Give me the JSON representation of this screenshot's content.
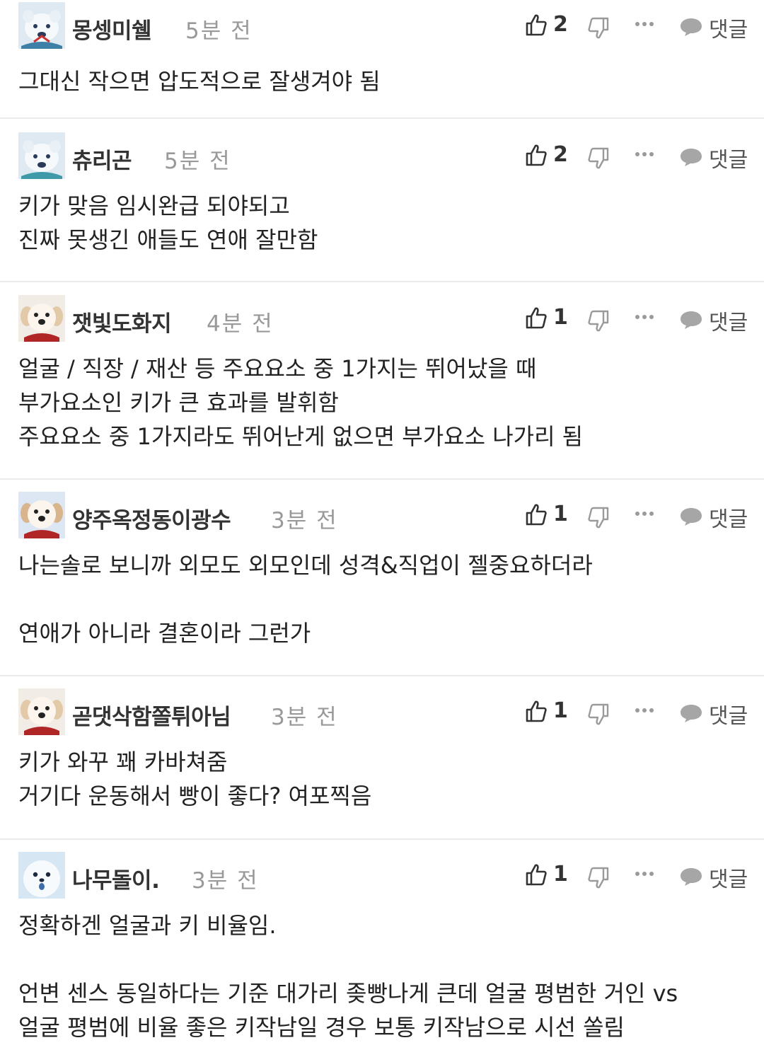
{
  "comments": [
    {
      "nickname": "몽셍미쉘",
      "time": "5분 전",
      "likes": "2",
      "reply_label": "댓글",
      "avatar": "polar-bear",
      "text": "그대신 작으면 압도적으로 잘생겨야 됨"
    },
    {
      "nickname": "츄리곤",
      "time": "5분 전",
      "likes": "2",
      "reply_label": "댓글",
      "avatar": "polar-bear",
      "text": "키가 맞음 임시완급 되야되고\n진짜 못생긴 애들도 연애 잘만함"
    },
    {
      "nickname": "잿빛도화지",
      "time": "4분 전",
      "likes": "1",
      "reply_label": "댓글",
      "avatar": "dog",
      "text": "얼굴 / 직장 / 재산 등 주요요소 중 1가지는 뛰어났을 때\n부가요소인 키가 큰 효과를 발휘함\n주요요소 중 1가지라도 뛰어난게 없으면 부가요소 나가리 됨"
    },
    {
      "nickname": "양주옥정동이광수",
      "time": "3분 전",
      "likes": "1",
      "reply_label": "댓글",
      "avatar": "dog",
      "text": "나는솔로 보니까 외모도 외모인데 성격&직업이 젤중요하더라\n\n연애가 아니라 결혼이라 그런가"
    },
    {
      "nickname": "곧댓삭함쫄튀아님",
      "time": "3분 전",
      "likes": "1",
      "reply_label": "댓글",
      "avatar": "dog",
      "text": "키가 와꾸 꽤 카바쳐줌\n거기다 운동해서 빵이 좋다? 여포찍음"
    },
    {
      "nickname": "나무돌이.",
      "time": "3분 전",
      "likes": "1",
      "reply_label": "댓글",
      "avatar": "seal",
      "text": "정확하겐 얼굴과 키 비율임.\n\n언변 센스 동일하다는 기준 대가리 좆빵나게 큰데 얼굴 평범한 거인 vs\n얼굴 평범에 비율 좋은 키작남일 경우 보통 키작남으로 시선 쏠림"
    }
  ],
  "colors": {
    "divider": "#ebebeb",
    "nickname": "#333333",
    "time": "#999999",
    "icon": "#9a9a9a"
  }
}
